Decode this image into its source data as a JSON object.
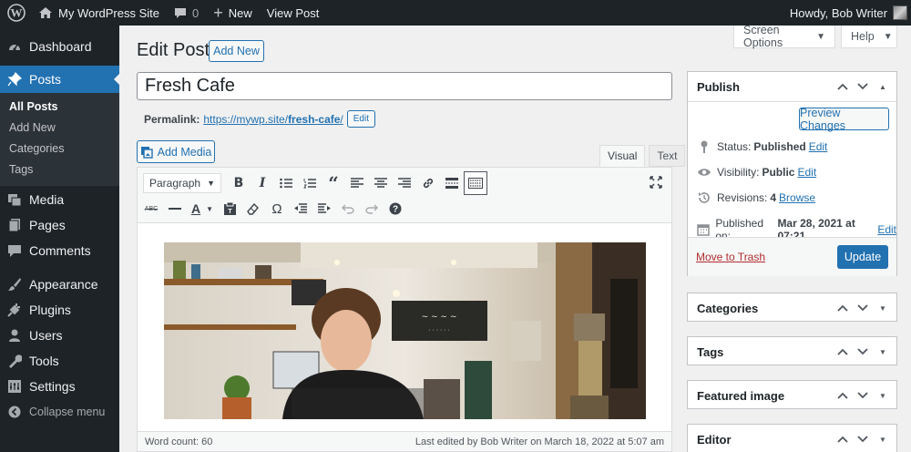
{
  "adminbar": {
    "site_name": "My WordPress Site",
    "comments_count": "0",
    "new_label": "New",
    "view_post": "View Post",
    "howdy": "Howdy, Bob Writer"
  },
  "sidebar": {
    "items": [
      {
        "label": "Dashboard",
        "icon": "dashboard-icon"
      },
      {
        "label": "Posts",
        "icon": "pin-icon"
      },
      {
        "label": "Media",
        "icon": "media-icon"
      },
      {
        "label": "Pages",
        "icon": "pages-icon"
      },
      {
        "label": "Comments",
        "icon": "comments-icon"
      },
      {
        "label": "Appearance",
        "icon": "brush-icon"
      },
      {
        "label": "Plugins",
        "icon": "plugin-icon"
      },
      {
        "label": "Users",
        "icon": "users-icon"
      },
      {
        "label": "Tools",
        "icon": "wrench-icon"
      },
      {
        "label": "Settings",
        "icon": "settings-icon"
      }
    ],
    "posts_submenu": [
      "All Posts",
      "Add New",
      "Categories",
      "Tags"
    ],
    "collapse": "Collapse menu"
  },
  "screen_options": "Screen Options",
  "help": "Help",
  "page": {
    "title": "Edit Post",
    "add_new": "Add New"
  },
  "post": {
    "title": "Fresh Cafe",
    "permalink_label": "Permalink:",
    "permalink_base": "https://mywp.site/",
    "permalink_slug": "fresh-cafe",
    "permalink_end": "/",
    "edit_label": "Edit"
  },
  "editor": {
    "add_media": "Add Media",
    "tab_visual": "Visual",
    "tab_text": "Text",
    "format": "Paragraph",
    "word_count": "Word count: 60",
    "last_edited": "Last edited by Bob Writer on March 18, 2022 at 5:07 am"
  },
  "publish": {
    "title": "Publish",
    "preview": "Preview Changes",
    "status_label": "Status:",
    "status_value": "Published",
    "visibility_label": "Visibility:",
    "visibility_value": "Public",
    "revisions_label": "Revisions:",
    "revisions_value": "4",
    "browse": "Browse",
    "published_on_label": "Published on:",
    "published_on_value": "Mar 28, 2021 at 07:21",
    "edit": "Edit",
    "trash": "Move to Trash",
    "update": "Update"
  },
  "boxes": {
    "categories": "Categories",
    "tags": "Tags",
    "featured_image": "Featured image",
    "editor": "Editor"
  },
  "colors": {
    "admin_dark": "#1d2327",
    "accent": "#2271b1",
    "trash_red": "#b32d2e"
  }
}
